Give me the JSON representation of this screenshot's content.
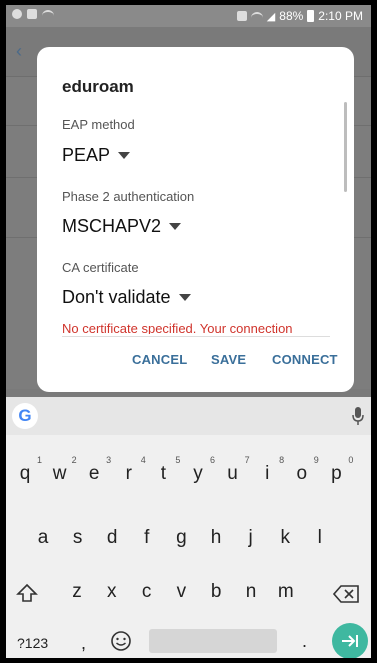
{
  "status_bar": {
    "battery_text": "88%",
    "time": "2:10 PM"
  },
  "dialog": {
    "title": "eduroam",
    "eap_label": "EAP method",
    "eap_value": "PEAP",
    "phase2_label": "Phase 2 authentication",
    "phase2_value": "MSCHAPV2",
    "ca_label": "CA certificate",
    "ca_value": "Don't validate",
    "warning": "No certificate specified. Your connection",
    "cancel": "CANCEL",
    "save": "SAVE",
    "connect": "CONNECT"
  },
  "keyboard": {
    "row1": [
      "q",
      "w",
      "e",
      "r",
      "t",
      "y",
      "u",
      "i",
      "o",
      "p"
    ],
    "row1_nums": [
      "1",
      "2",
      "3",
      "4",
      "5",
      "6",
      "7",
      "8",
      "9",
      "0"
    ],
    "row2": [
      "a",
      "s",
      "d",
      "f",
      "g",
      "h",
      "j",
      "k",
      "l"
    ],
    "row3": [
      "z",
      "x",
      "c",
      "v",
      "b",
      "n",
      "m"
    ],
    "sym_key": "?123",
    "comma": ",",
    "period": ".",
    "google_letter": "G"
  },
  "colors": {
    "accent": "#3a6f9a",
    "warning": "#d0342c",
    "enter_key": "#3fb8a0"
  }
}
